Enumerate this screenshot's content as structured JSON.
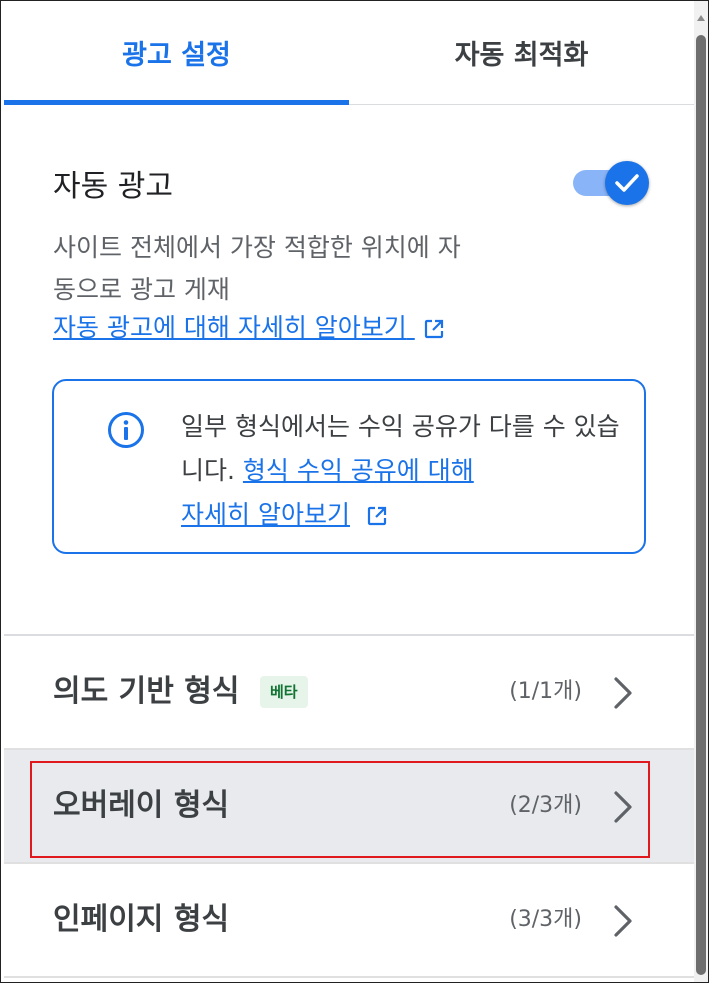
{
  "tabs": {
    "settings_label": "광고 설정",
    "optimize_label": "자동 최적화"
  },
  "auto_ads": {
    "title": "자동 광고",
    "toggle_on": true,
    "description_line1": "사이트 전체에서 가장 적합한 위치에 자",
    "description_line2": "동으로 광고 게재",
    "learn_more_link": "자동 광고에 대해 자세히 알아보기"
  },
  "info_notice": {
    "text_before_link": "일부 형식에서는 수익 공유가 다를 수 있습니다. ",
    "link_part1": "형식 수익 공유에 대해",
    "link_part2": "자세히 알아보기"
  },
  "formats": [
    {
      "label": "의도 기반 형식",
      "badge": "베타",
      "count": "(1/1개)"
    },
    {
      "label": "오버레이 형식",
      "badge": "",
      "count": "(2/3개)"
    },
    {
      "label": "인페이지 형식",
      "badge": "",
      "count": "(3/3개)"
    }
  ],
  "colors": {
    "accent": "#1a73e8",
    "highlight": "#e0191e",
    "selected_row_bg": "#e8eaed",
    "beta_bg": "#e6f4ea",
    "beta_text": "#137333"
  },
  "icons": [
    "checkmark-icon",
    "external-link-icon",
    "info-icon",
    "chevron-right-icon"
  ]
}
